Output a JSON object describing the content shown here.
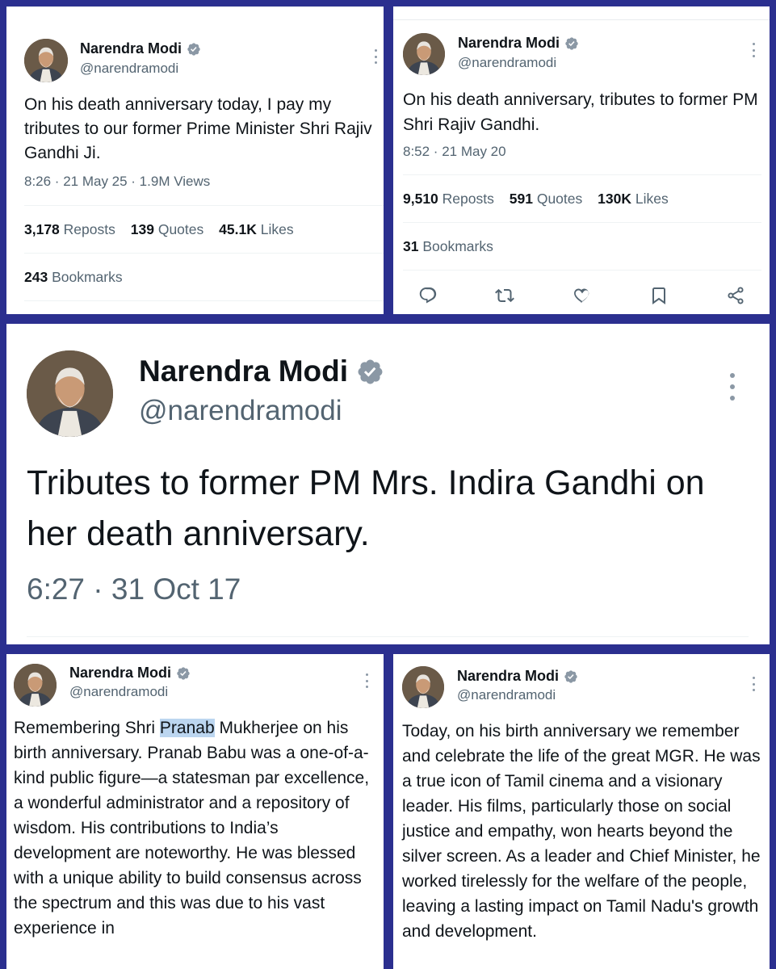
{
  "author": {
    "name": "Narendra Modi",
    "handle": "@narendramodi",
    "avatar_icon": "profile-photo-icon",
    "verified_icon": "verified-badge-icon"
  },
  "colors": {
    "frame": "#2b2f8f",
    "badge": "#1d9bf0",
    "muted": "#536471"
  },
  "tweets": [
    {
      "text": "On his death anniversary today, I pay my tributes to our former Prime Minister Shri Rajiv Gandhi Ji.",
      "meta": "8:26 · 21 May 25 · 1.9M Views",
      "reposts_count": "3,178",
      "reposts_label": "Reposts",
      "quotes_count": "139",
      "quotes_label": "Quotes",
      "likes_count": "45.1K",
      "likes_label": "Likes",
      "bookmarks_count": "243",
      "bookmarks_label": "Bookmarks"
    },
    {
      "text": "On his death anniversary, tributes to former PM Shri Rajiv Gandhi.",
      "meta": "8:52 · 21 May 20",
      "reposts_count": "9,510",
      "reposts_label": "Reposts",
      "quotes_count": "591",
      "quotes_label": "Quotes",
      "likes_count": "130K",
      "likes_label": "Likes",
      "bookmarks_count": "31",
      "bookmarks_label": "Bookmarks",
      "actions": [
        "reply-icon",
        "repost-icon",
        "like-icon",
        "bookmark-icon",
        "share-icon"
      ]
    },
    {
      "text": "Tributes to former PM Mrs. Indira Gandhi on her death anniversary.",
      "meta": "6:27 · 31 Oct 17"
    },
    {
      "text_before": "Remembering Shri ",
      "text_highlight": "Pranab",
      "text_after": " Mukherjee on his birth anniversary. Pranab Babu was a one-of-a-kind public figure—a statesman par excellence, a wonderful administrator and a repository of wisdom. His contributions to India’s development are noteworthy. He was blessed with a unique ability to build consensus across the spectrum and this was due to his vast experience in"
    },
    {
      "text": "Today, on his birth anniversary we remember and celebrate the life of the great MGR. He was a true icon of Tamil cinema and a visionary leader. His films, particularly those on social justice and empathy, won hearts beyond the silver screen. As a leader and Chief Minister, he worked tirelessly for the welfare of the people, leaving a lasting impact on Tamil Nadu's growth and development."
    }
  ]
}
